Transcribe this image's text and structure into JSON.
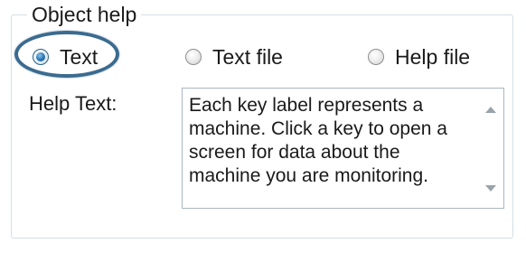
{
  "object_help": {
    "legend": "Object help",
    "radio_options": [
      {
        "label": "Text",
        "selected": true
      },
      {
        "label": "Text file",
        "selected": false
      },
      {
        "label": "Help file",
        "selected": false
      }
    ],
    "help_text_label": "Help Text:",
    "help_text_value": "Each key label represents a machine. Click a key to open a screen for data about the machine you are monitoring."
  },
  "colors": {
    "highlight_ring": "#3b6b8f",
    "group_border": "#d5dfe5",
    "selected_dot": "#2a7ab8"
  }
}
